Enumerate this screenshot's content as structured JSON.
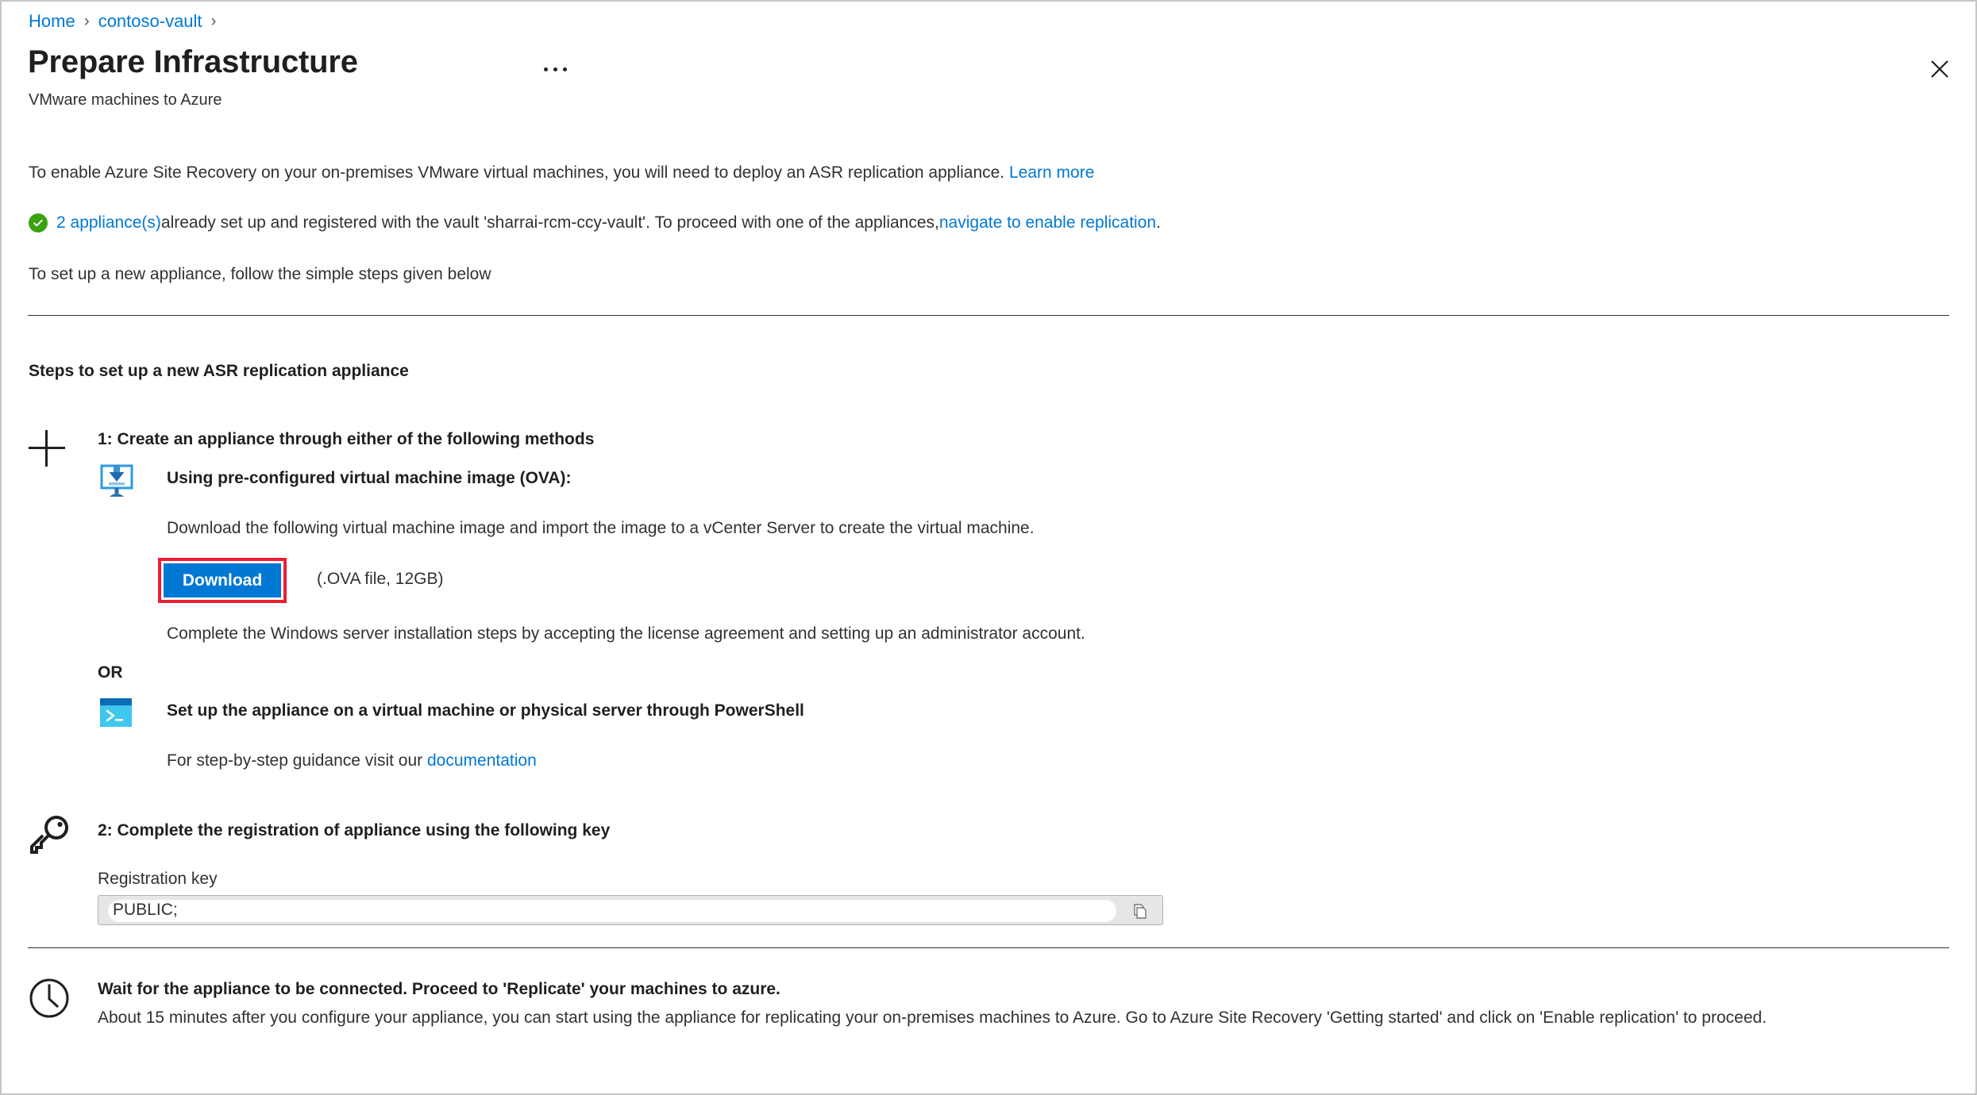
{
  "breadcrumb": {
    "items": [
      {
        "label": "Home"
      },
      {
        "label": "contoso-vault"
      }
    ],
    "separator": "›"
  },
  "header": {
    "title": "Prepare Infrastructure",
    "subtitle": "VMware machines to Azure",
    "more_options_icon": "ellipsis-icon",
    "close_icon": "close-icon"
  },
  "intro": {
    "line1_text": "To enable Azure Site Recovery on your on-premises VMware virtual machines, you will need to deploy an ASR replication appliance. ",
    "line1_link": "Learn more",
    "status_icon": "success-check-icon",
    "line2_link_count": "2 appliance(s)",
    "line2_text_mid": " already set up and registered with the vault 'sharrai-rcm-ccy-vault'. To proceed with one of the appliances, ",
    "line2_link_nav": "navigate to enable replication",
    "line2_text_end": ".",
    "line3_text": "To set up a new appliance, follow the simple steps given below"
  },
  "steps": {
    "heading": "Steps to set up a new ASR replication appliance",
    "step1": {
      "icon": "plus-icon",
      "title": "1: Create an appliance through either of the following methods",
      "ova": {
        "icon": "monitor-download-icon",
        "heading": "Using pre-configured virtual machine image (OVA):",
        "description": "Download the following virtual machine image and import the image to a vCenter Server to create the virtual machine.",
        "download_button_label": "Download",
        "download_meta": "(.OVA file, 12GB)",
        "highlight_color": "#ed1c35",
        "button_color": "#0078d4",
        "note": "Complete the Windows server installation steps by accepting the license agreement and setting up an administrator account."
      },
      "or_label": "OR",
      "powershell": {
        "icon": "powershell-icon",
        "heading": "Set up the appliance on a virtual machine or physical server through PowerShell",
        "doc_text": "For step-by-step guidance visit our ",
        "doc_link": "documentation"
      }
    },
    "step2": {
      "icon": "key-icon",
      "title": "2: Complete the registration of appliance using the following key",
      "field_label": "Registration key",
      "field_value": "PUBLIC;",
      "copy_icon": "copy-icon"
    }
  },
  "wait_section": {
    "icon": "clock-icon",
    "title": "Wait for the appliance to be connected. Proceed to 'Replicate' your machines to azure.",
    "description": "About 15 minutes after you configure your appliance, you can start using the appliance for replicating your on-premises machines to Azure. Go to Azure Site Recovery 'Getting started' and click on 'Enable replication' to proceed."
  },
  "colors": {
    "accent": "#0078d4",
    "success": "#3aa110",
    "highlight": "#ed1c35",
    "text": "#201f1e"
  }
}
